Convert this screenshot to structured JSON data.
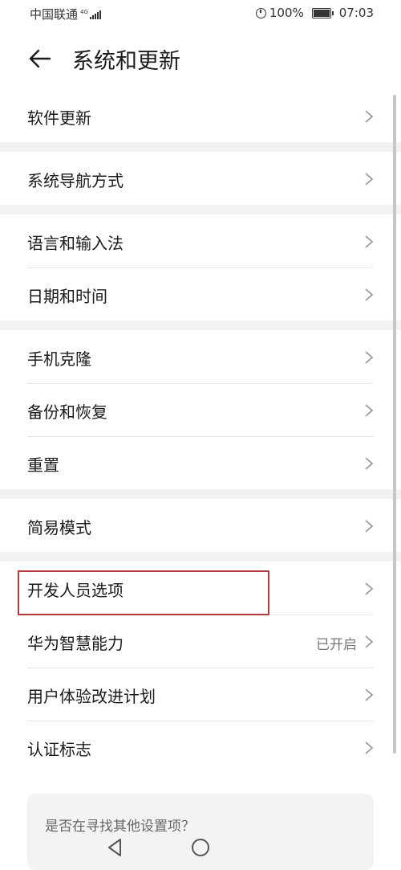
{
  "status_bar": {
    "carrier": "中国联通",
    "network": "4G",
    "battery": "100%",
    "time": "07:03"
  },
  "header": {
    "title": "系统和更新"
  },
  "groups": [
    {
      "items": [
        {
          "label": "软件更新"
        }
      ]
    },
    {
      "items": [
        {
          "label": "系统导航方式"
        }
      ]
    },
    {
      "items": [
        {
          "label": "语言和输入法"
        },
        {
          "label": "日期和时间"
        }
      ]
    },
    {
      "items": [
        {
          "label": "手机克隆"
        },
        {
          "label": "备份和恢复"
        },
        {
          "label": "重置"
        }
      ]
    },
    {
      "items": [
        {
          "label": "简易模式"
        }
      ]
    },
    {
      "items": [
        {
          "label": "开发人员选项"
        },
        {
          "label": "华为智慧能力",
          "value": "已开启"
        },
        {
          "label": "用户体验改进计划"
        },
        {
          "label": "认证标志"
        }
      ]
    }
  ],
  "suggestion": {
    "text": "是否在寻找其他设置项？"
  },
  "colors": {
    "highlight": "#b23a3a",
    "separator": "#f2f2f2"
  }
}
